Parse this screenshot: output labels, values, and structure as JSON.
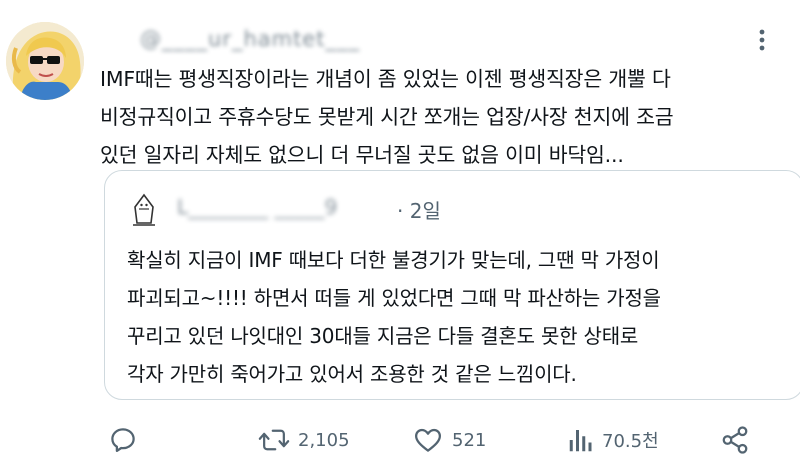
{
  "tweet": {
    "handle": "@____ur_hamtet___",
    "text": "IMF때는 평생직장이라는 개념이 좀 있었는 이젠 평생직장은 개뿔 다\n비정규직이고 주휴수당도 못받게 시간 쪼개는 업장/사장 천지에 조금\n있던 일자리 자체도 없으니 더 무너질 곳도 없음 이미 바닥임..."
  },
  "quote": {
    "name": "L________ _____9",
    "time": "· 2일",
    "text": "확실히 지금이 IMF 때보다 더한 불경기가 맞는데, 그땐 막 가정이\n파괴되고~!!!! 하면서 떠들 게 있었다면 그때 막 파산하는 가정을\n꾸리고 있던 나잇대인 30대들 지금은 다들 결혼도 못한 상태로\n각자 가만히 죽어가고 있어서 조용한 것 같은 느낌이다."
  },
  "actions": {
    "reply": {
      "icon": "reply-icon",
      "count": ""
    },
    "retweet": {
      "icon": "retweet-icon",
      "count": "2,105"
    },
    "like": {
      "icon": "heart-icon",
      "count": "521"
    },
    "views": {
      "icon": "views-icon",
      "count": "70.5천"
    },
    "share": {
      "icon": "share-icon",
      "count": ""
    }
  },
  "colors": {
    "text": "#0f1419",
    "secondary": "#536471",
    "border": "#cfd9de"
  }
}
